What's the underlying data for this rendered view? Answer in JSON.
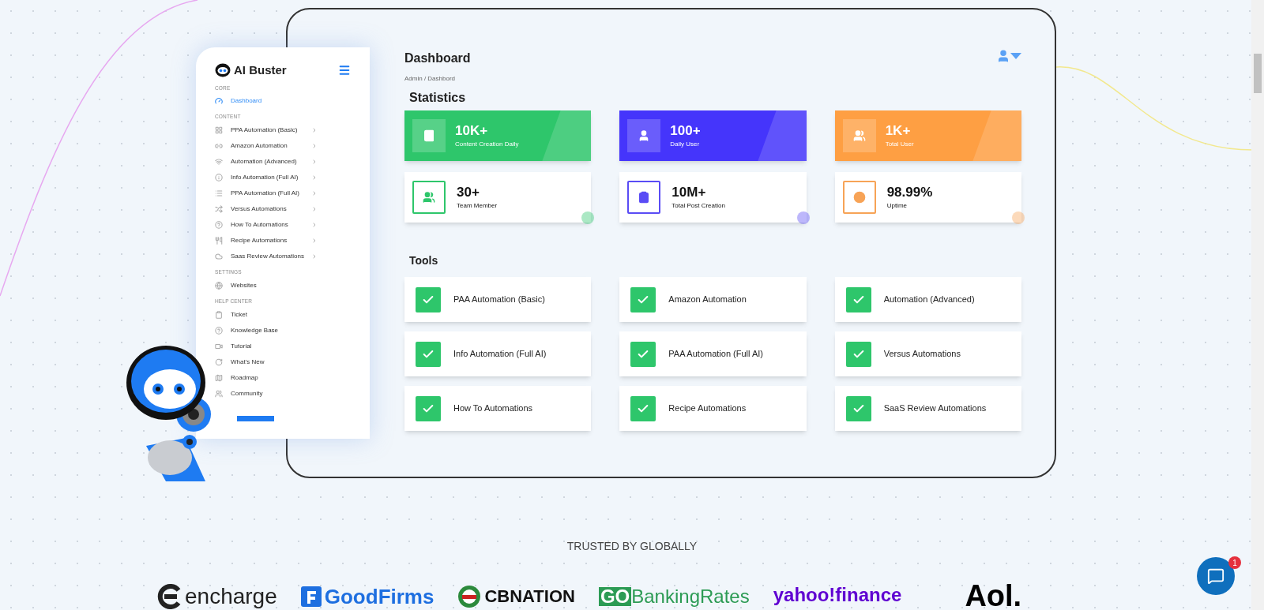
{
  "sidebar": {
    "brand": "AI Buster",
    "sections": [
      {
        "label": "CORE",
        "items": [
          {
            "label": "Dashboard",
            "selected": true,
            "has_arrow": false
          }
        ]
      },
      {
        "label": "CONTENT",
        "items": [
          {
            "label": "PPA Automation (Basic)",
            "selected": false,
            "has_arrow": true
          },
          {
            "label": "Amazon Automation",
            "selected": false,
            "has_arrow": true
          },
          {
            "label": "Automation (Advanced)",
            "selected": false,
            "has_arrow": true
          },
          {
            "label": "Info Automation (Full AI)",
            "selected": false,
            "has_arrow": true
          },
          {
            "label": "PPA Automation (Full AI)",
            "selected": false,
            "has_arrow": true
          },
          {
            "label": "Versus Automations",
            "selected": false,
            "has_arrow": true
          },
          {
            "label": "How To Automations",
            "selected": false,
            "has_arrow": true
          },
          {
            "label": "Recipe Automations",
            "selected": false,
            "has_arrow": true
          },
          {
            "label": "Saas Review Automations",
            "selected": false,
            "has_arrow": true
          }
        ]
      },
      {
        "label": "SETTINGS",
        "items": [
          {
            "label": "Websites",
            "selected": false,
            "has_arrow": false
          }
        ]
      },
      {
        "label": "HELP CENTER",
        "items": [
          {
            "label": "Ticket",
            "selected": false,
            "has_arrow": false
          },
          {
            "label": "Knowledge Base",
            "selected": false,
            "has_arrow": false
          },
          {
            "label": "Tutorial",
            "selected": false,
            "has_arrow": false
          },
          {
            "label": "What's New",
            "selected": false,
            "has_arrow": false
          },
          {
            "label": "Roadmap",
            "selected": false,
            "has_arrow": false
          },
          {
            "label": "Community",
            "selected": false,
            "has_arrow": false
          }
        ]
      }
    ]
  },
  "header": {
    "title": "Dashboard",
    "breadcrumb": "Admin / Dashbord"
  },
  "statistics": {
    "title": "Statistics",
    "cards": [
      {
        "kind": "filled",
        "color": "#2ec66b",
        "value": "10K+",
        "label": "Content Creation Daily"
      },
      {
        "kind": "filled",
        "color": "#4535fb",
        "value": "100+",
        "label": "Daily User"
      },
      {
        "kind": "filled",
        "color": "#fe9f43",
        "value": "1K+",
        "label": "Total User"
      },
      {
        "kind": "outlined",
        "color": "#2ec66b",
        "value": "30+",
        "label": "Team Member"
      },
      {
        "kind": "outlined",
        "color": "#5a4cf5",
        "value": "10M+",
        "label": "Total Post Creation"
      },
      {
        "kind": "outlined",
        "color": "#f7a356",
        "value": "98.99%",
        "label": "Uptime"
      }
    ]
  },
  "tools": {
    "title": "Tools",
    "items": [
      {
        "label": "PAA Automation (Basic)",
        "checked": true
      },
      {
        "label": "Amazon Automation",
        "checked": true
      },
      {
        "label": "Automation (Advanced)",
        "checked": true
      },
      {
        "label": "Info Automation (Full AI)",
        "checked": true
      },
      {
        "label": "PAA Automation (Full AI)",
        "checked": true
      },
      {
        "label": "Versus Automations",
        "checked": true
      },
      {
        "label": "How To Automations",
        "checked": true
      },
      {
        "label": "Recipe Automations",
        "checked": true
      },
      {
        "label": "SaaS Review Automations",
        "checked": true
      }
    ]
  },
  "trusted": {
    "title": "TRUSTED BY GLOBALLY",
    "logos": [
      {
        "kind": "encharge",
        "text": "encharge"
      },
      {
        "kind": "goodfirms",
        "text": "GoodFirms"
      },
      {
        "kind": "cbnation",
        "text": "CBNATION"
      },
      {
        "kind": "bankingrates",
        "badge": "GO",
        "text": "BankingRates"
      },
      {
        "kind": "yahoo",
        "text": "yahoo!finance"
      },
      {
        "kind": "aol",
        "text": "Aol."
      }
    ]
  },
  "chat": {
    "badge": "1"
  }
}
